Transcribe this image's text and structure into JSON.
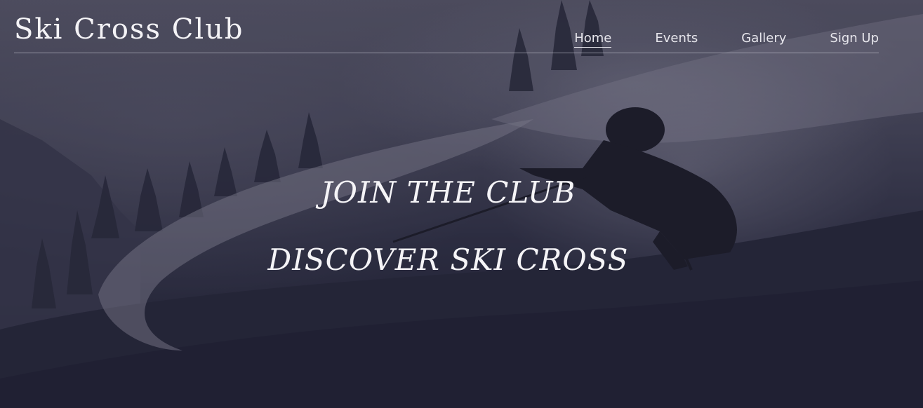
{
  "header": {
    "logo": "Ski Cross Club"
  },
  "nav": {
    "items": [
      {
        "label": "Home",
        "active": true
      },
      {
        "label": "Events",
        "active": false
      },
      {
        "label": "Gallery",
        "active": false
      },
      {
        "label": "Sign Up",
        "active": false
      }
    ]
  },
  "hero": {
    "line1": "JOIN THE CLUB",
    "line2": "DISCOVER SKI CROSS"
  },
  "colors": {
    "text": "#f5f4f7",
    "overlay": "#2f3044"
  }
}
